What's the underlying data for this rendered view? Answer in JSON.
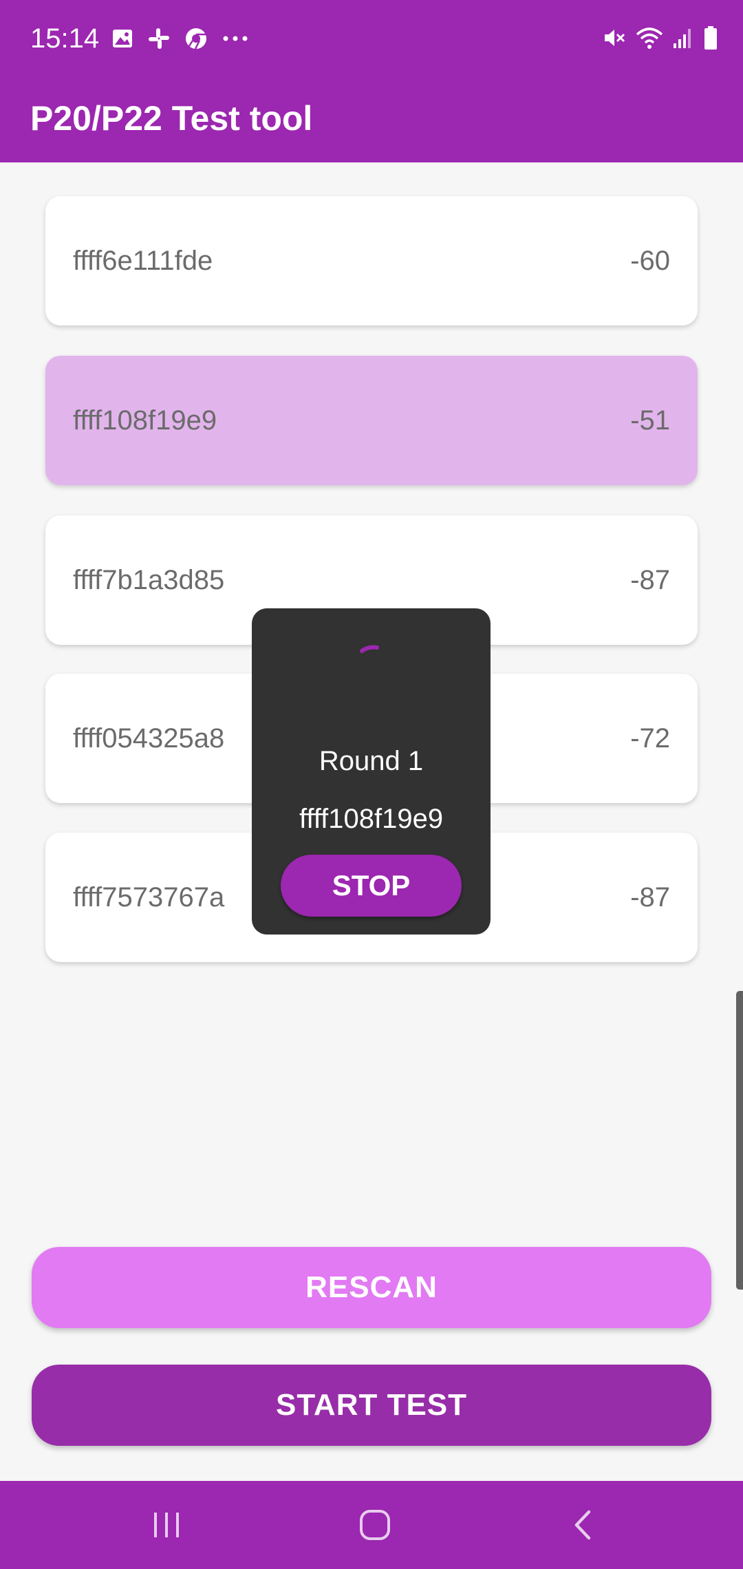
{
  "status_bar": {
    "time": "15:14",
    "left_icons": [
      "gallery-icon",
      "slack-icon",
      "chrome-icon",
      "more-notifications-icon"
    ],
    "right_icons": [
      "mute-icon",
      "wifi-icon",
      "signal-icon",
      "battery-icon"
    ]
  },
  "app_bar": {
    "title": "P20/P22 Test tool"
  },
  "devices": [
    {
      "id": "ffff6e111fde",
      "rssi": "-60",
      "selected": false
    },
    {
      "id": "ffff108f19e9",
      "rssi": "-51",
      "selected": true
    },
    {
      "id": "ffff7b1a3d85",
      "rssi": "-87",
      "selected": false
    },
    {
      "id": "ffff054325a8",
      "rssi": "-72",
      "selected": false
    },
    {
      "id": "ffff7573767a",
      "rssi": "-87",
      "selected": false
    }
  ],
  "dialog": {
    "round_label": "Round 1",
    "device_label": "ffff108f19e9",
    "stop_label": "STOP"
  },
  "buttons": {
    "rescan_label": "RESCAN",
    "start_test_label": "START TEST"
  },
  "colors": {
    "primary": "#9c27b0",
    "selected_row": "#e2b4ec",
    "rescan": "#e27af3",
    "start_test": "#972da8",
    "dialog_bg": "#323232"
  },
  "nav_bar": {
    "icons": [
      "recents-icon",
      "home-icon",
      "back-icon"
    ]
  }
}
